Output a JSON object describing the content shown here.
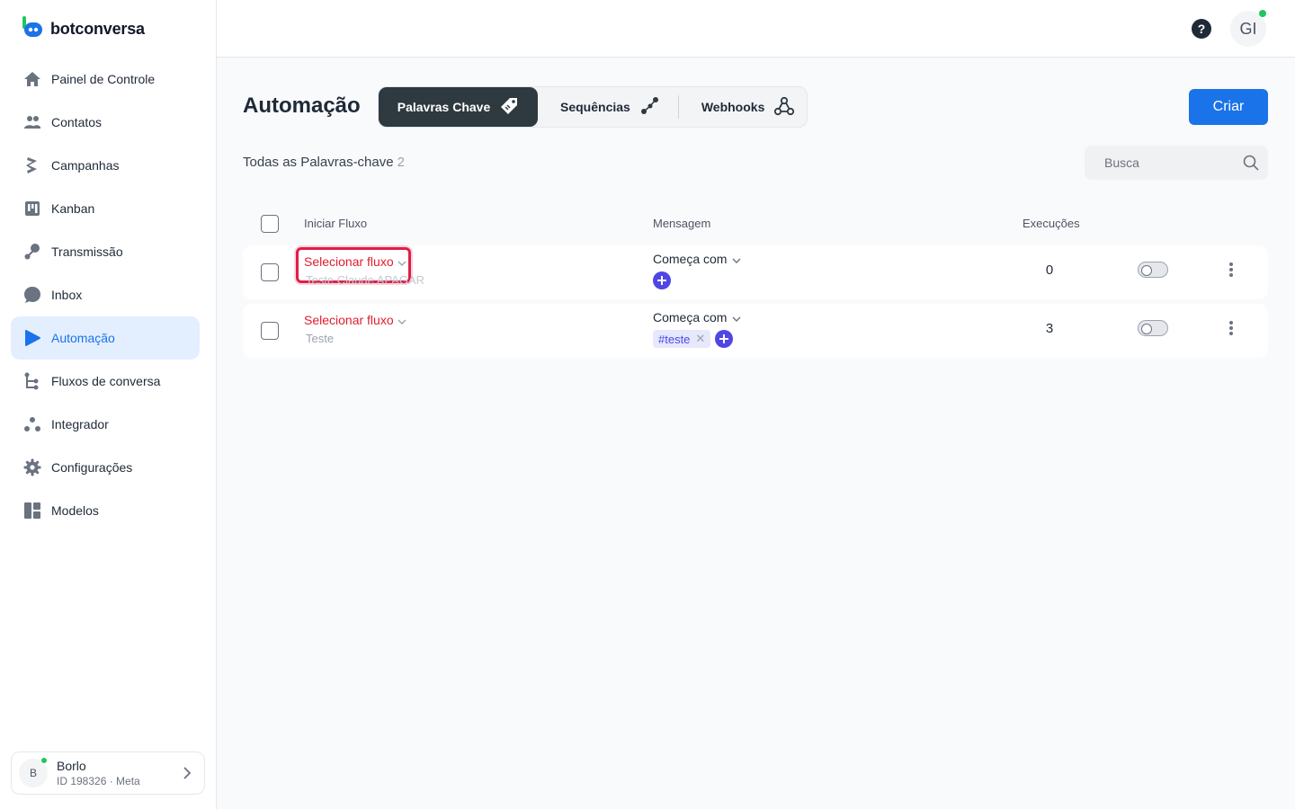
{
  "brand": {
    "name": "botconversa"
  },
  "sidebar": {
    "items": [
      {
        "label": "Painel de Controle",
        "icon": "home-icon"
      },
      {
        "label": "Contatos",
        "icon": "users-icon"
      },
      {
        "label": "Campanhas",
        "icon": "campaign-icon"
      },
      {
        "label": "Kanban",
        "icon": "kanban-icon"
      },
      {
        "label": "Transmissão",
        "icon": "broadcast-icon"
      },
      {
        "label": "Inbox",
        "icon": "chat-bubble-icon"
      },
      {
        "label": "Automação",
        "icon": "play-icon",
        "active": true
      },
      {
        "label": "Fluxos de conversa",
        "icon": "flow-icon"
      },
      {
        "label": "Integrador",
        "icon": "integrator-icon"
      },
      {
        "label": "Configurações",
        "icon": "gear-icon"
      },
      {
        "label": "Modelos",
        "icon": "templates-icon"
      }
    ],
    "account": {
      "initial": "B",
      "name": "Borlo",
      "id": "ID 198326 · Meta"
    }
  },
  "header": {
    "help_icon": "help-icon",
    "user_initials": "GI"
  },
  "main": {
    "title": "Automação",
    "tabs": [
      {
        "label": "Palavras Chave",
        "icon": "tag-icon",
        "active": true
      },
      {
        "label": "Sequências",
        "icon": "sequence-icon"
      },
      {
        "label": "Webhooks",
        "icon": "webhook-icon"
      }
    ],
    "create_label": "Criar",
    "section_label": "Todas as Palavras-chave",
    "section_count": "2",
    "search_placeholder": "Busca",
    "columns": {
      "flow": "Iniciar Fluxo",
      "message": "Mensagem",
      "executions": "Execuções"
    },
    "rows": [
      {
        "flow_select": "Selecionar fluxo",
        "flow_name": "Teste Claude APAGAR",
        "match_type": "Começa com",
        "keywords": [],
        "executions": "0",
        "enabled": false
      },
      {
        "flow_select": "Selecionar fluxo",
        "flow_name": "Teste",
        "match_type": "Começa com",
        "keywords": [
          "#teste"
        ],
        "executions": "3",
        "enabled": false
      }
    ]
  },
  "colors": {
    "accent": "#1a73e8",
    "active_tab": "#2f3940",
    "flow_red": "#e11d2e",
    "plus_indigo": "#4f46e5",
    "online_green": "#22c55e"
  }
}
